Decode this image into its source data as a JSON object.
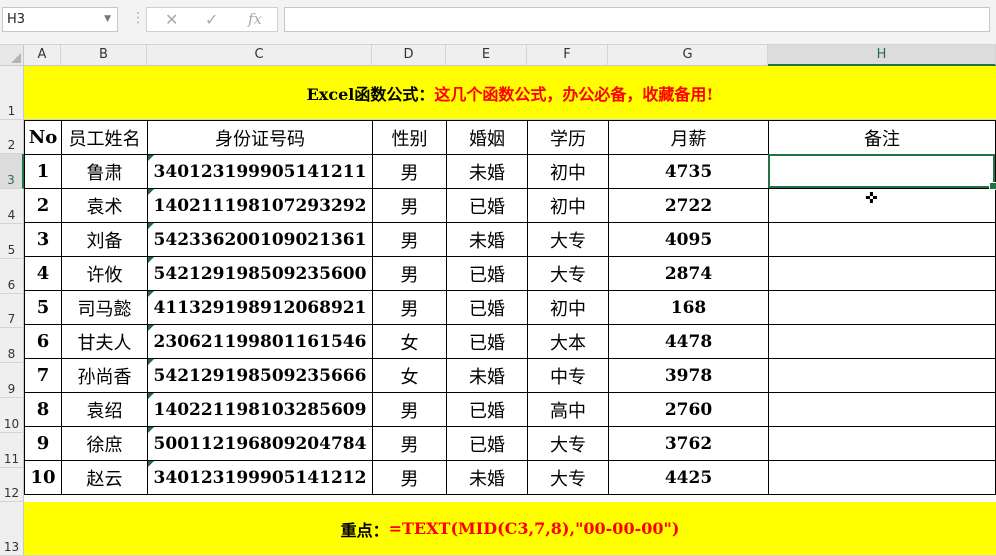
{
  "formula_bar": {
    "name_box": "H3",
    "dropdown_icon": "chevron-down-icon",
    "cancel_icon": "cancel-x-icon",
    "enter_icon": "checkmark-icon",
    "fx_icon": "function-icon",
    "formula_value": ""
  },
  "columns": [
    "A",
    "B",
    "C",
    "D",
    "E",
    "F",
    "G",
    "H"
  ],
  "selected_column": "H",
  "rows": [
    "1",
    "2",
    "3",
    "4",
    "5",
    "6",
    "7",
    "8",
    "9",
    "10",
    "11",
    "12",
    "13"
  ],
  "selected_row": "3",
  "title": {
    "prefix": "Excel函数公式：",
    "highlight": "这几个函数公式，办公必备，收藏备用!"
  },
  "table": {
    "headers": [
      "No",
      "员工姓名",
      "身份证号码",
      "性别",
      "婚姻",
      "学历",
      "月薪",
      "备注"
    ],
    "rows": [
      [
        "1",
        "鲁肃",
        "340123199905141211",
        "男",
        "未婚",
        "初中",
        "4735",
        ""
      ],
      [
        "2",
        "袁术",
        "140211198107293292",
        "男",
        "已婚",
        "初中",
        "2722",
        ""
      ],
      [
        "3",
        "刘备",
        "542336200109021361",
        "男",
        "未婚",
        "大专",
        "4095",
        ""
      ],
      [
        "4",
        "许攸",
        "542129198509235600",
        "男",
        "已婚",
        "大专",
        "2874",
        ""
      ],
      [
        "5",
        "司马懿",
        "411329198912068921",
        "男",
        "已婚",
        "初中",
        "168",
        ""
      ],
      [
        "6",
        "甘夫人",
        "230621199801161546",
        "女",
        "已婚",
        "大本",
        "4478",
        ""
      ],
      [
        "7",
        "孙尚香",
        "542129198509235666",
        "女",
        "未婚",
        "中专",
        "3978",
        ""
      ],
      [
        "8",
        "袁绍",
        "140221198103285609",
        "男",
        "已婚",
        "高中",
        "2760",
        ""
      ],
      [
        "9",
        "徐庶",
        "500112196809204784",
        "男",
        "已婚",
        "大专",
        "3762",
        ""
      ],
      [
        "10",
        "赵云",
        "340123199905141212",
        "男",
        "未婚",
        "大专",
        "4425",
        ""
      ]
    ]
  },
  "footer": {
    "label": "重点：",
    "formula": "=TEXT(MID(C3,7,8),\"00-00-00\")"
  },
  "colors": {
    "band_yellow": "#ffff00",
    "highlight_red": "#ff0000",
    "selection_green": "#217346"
  }
}
